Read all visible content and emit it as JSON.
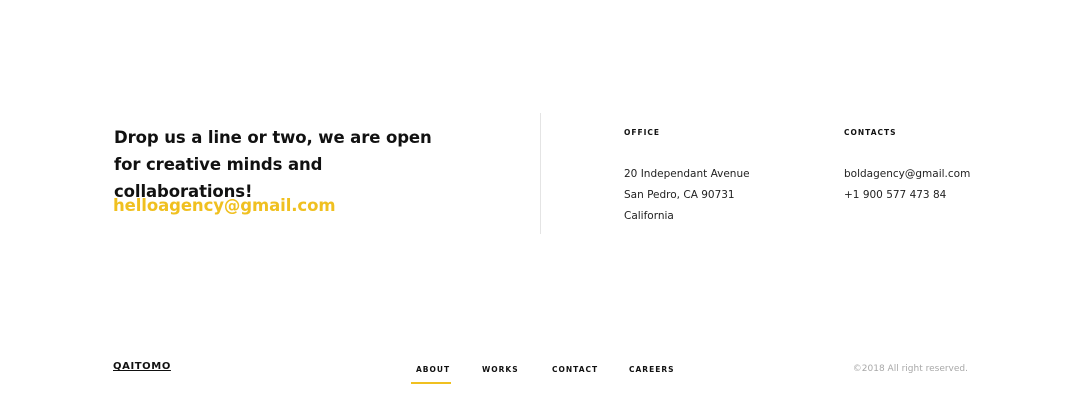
{
  "colors": {
    "accent": "#f0c020",
    "text": "#111111",
    "muted": "#a8a8a8"
  },
  "contact_intro": {
    "headline": "Drop us a line or two, we are open for creative minds and collaborations!",
    "email": "helloagency@gmail.com"
  },
  "office": {
    "heading": "OFFICE",
    "lines": [
      "20 Independant Avenue",
      "San Pedro, CA 90731",
      "California"
    ]
  },
  "contacts": {
    "heading": "CONTACTS",
    "lines": [
      "boldagency@gmail.com",
      "+1 900 577 473 84"
    ]
  },
  "footer": {
    "logo": "QAITOMO",
    "nav": [
      {
        "label": "ABOUT",
        "active": true
      },
      {
        "label": "WORKS",
        "active": false
      },
      {
        "label": "CONTACT",
        "active": false
      },
      {
        "label": "CAREERS",
        "active": false
      }
    ],
    "copyright": "©2018 All right reserved."
  }
}
